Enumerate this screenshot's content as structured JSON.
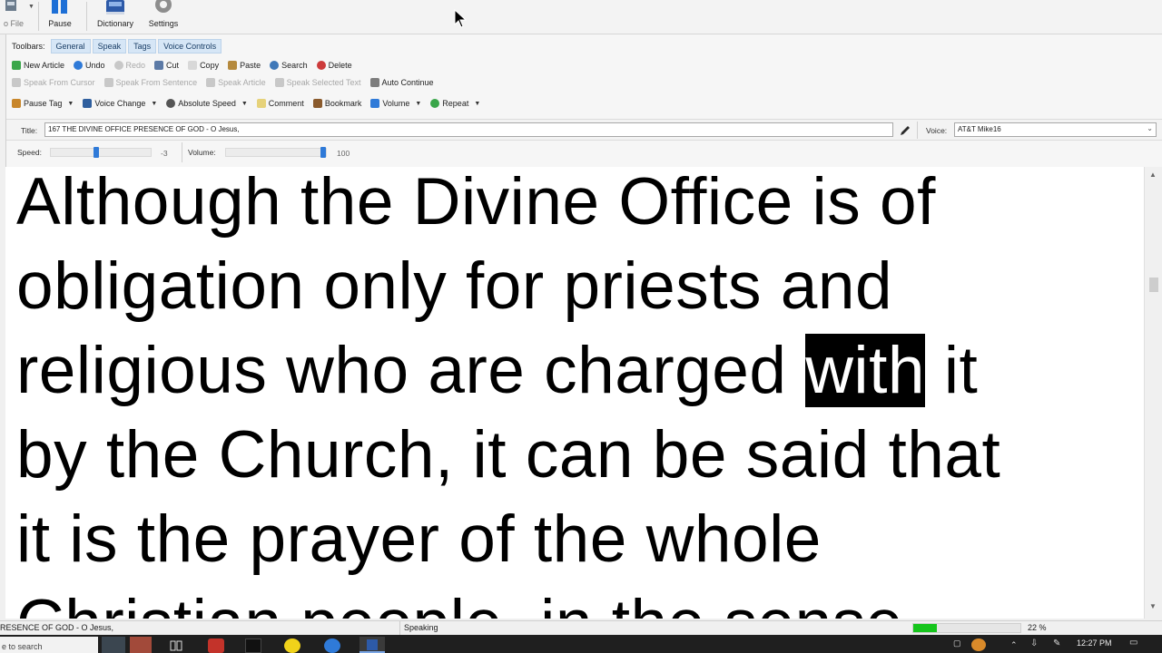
{
  "ribbon": {
    "file_label": "o File",
    "pause_label": "Pause",
    "dictionary_label": "Dictionary",
    "settings_label": "Settings"
  },
  "toolbars": {
    "label": "Toolbars:",
    "tabs": [
      "General",
      "Speak",
      "Tags",
      "Voice Controls"
    ],
    "row1": [
      "New Article",
      "Undo",
      "Redo",
      "Cut",
      "Copy",
      "Paste",
      "Search",
      "Delete"
    ],
    "row2": [
      "Speak From Cursor",
      "Speak From Sentence",
      "Speak Article",
      "Speak Selected Text",
      "Auto Continue"
    ],
    "row3": [
      "Pause Tag",
      "Voice Change",
      "Absolute Speed",
      "Comment",
      "Bookmark",
      "Volume",
      "Repeat"
    ]
  },
  "title_bar": {
    "title_label": "Title:",
    "title_value": "167 THE DIVINE OFFICE PRESENCE OF GOD - O Jesus,",
    "voice_label": "Voice:",
    "voice_value": "AT&T Mike16"
  },
  "sliders": {
    "speed_label": "Speed:",
    "speed_value": "-3",
    "speed_level": 0.45,
    "volume_label": "Volume:",
    "volume_value": "100",
    "volume_level": 1.0
  },
  "reader": {
    "line1": "Although the Divine Office is of",
    "line2": "obligation only for priests and",
    "line3_before": "religious who are charged ",
    "line3_highlight": "with",
    "line3_after": " it",
    "line4": "by the Church, it can be said that",
    "line5": "it is the prayer of the whole",
    "line6": "Christian people, in the sense"
  },
  "status": {
    "article": "RESENCE OF GOD - O Jesus,",
    "state": "Speaking",
    "progress_percent": "22 %",
    "progress_fraction": 0.22
  },
  "taskbar": {
    "search_text": "e to search",
    "clock": "12:27 PM"
  },
  "colors": {
    "accent_blue": "#2f7ad8",
    "progress_green": "#16c51c",
    "highlight_bg": "#000000",
    "highlight_fg": "#ffffff"
  }
}
